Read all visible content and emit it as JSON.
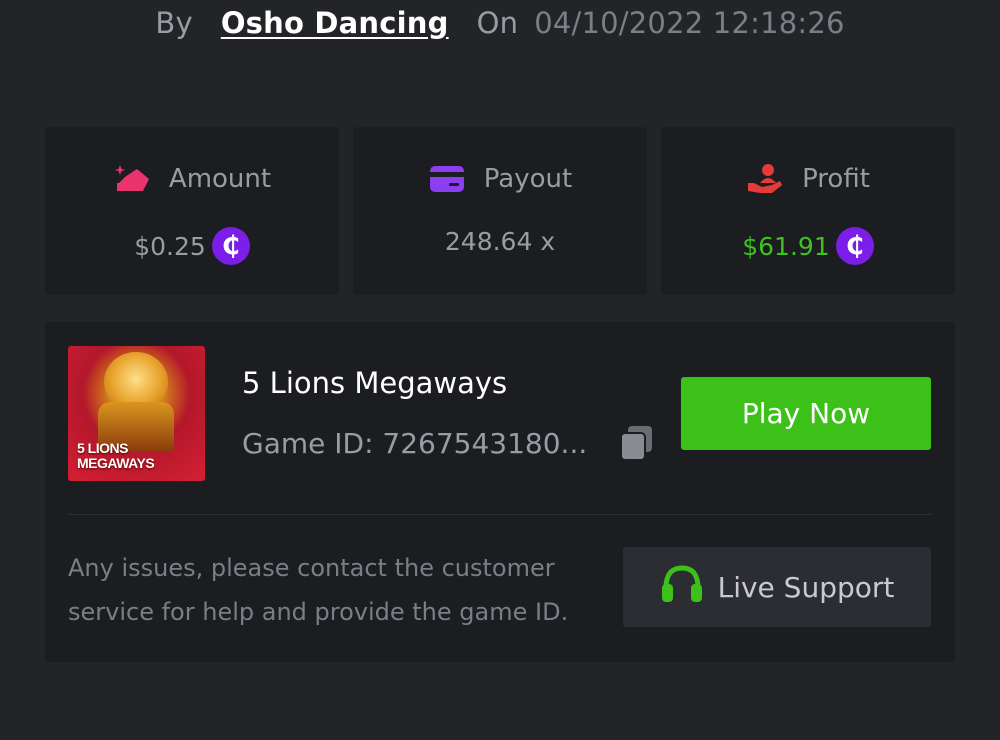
{
  "header": {
    "by_label": "By",
    "author": "Osho Dancing",
    "on_label": "On",
    "timestamp": "04/10/2022 12:18:26"
  },
  "stats": {
    "amount": {
      "label": "Amount",
      "value": "$0.25",
      "icon": "amount-icon",
      "color": "#e8336e"
    },
    "payout": {
      "label": "Payout",
      "value": "248.64 x",
      "icon": "credit-card-icon",
      "color": "#8b3ff0"
    },
    "profit": {
      "label": "Profit",
      "value": "$61.91",
      "icon": "hand-user-icon",
      "color": "#e33a3a",
      "value_color": "#3ec21f"
    },
    "coin_symbol": "₵",
    "coin_color": "#7b1ee8"
  },
  "game": {
    "title": "5 Lions Megaways",
    "thumbnail_text": "5 LIONS MEGAWAYS",
    "game_id": "Game ID: 7267543180...",
    "play_label": "Play Now",
    "play_color": "#3bc117"
  },
  "support": {
    "help_text": "Any issues, please contact the customer service for help and provide the game ID.",
    "button_label": "Live Support",
    "icon": "headset-icon",
    "icon_color": "#3bc117"
  }
}
